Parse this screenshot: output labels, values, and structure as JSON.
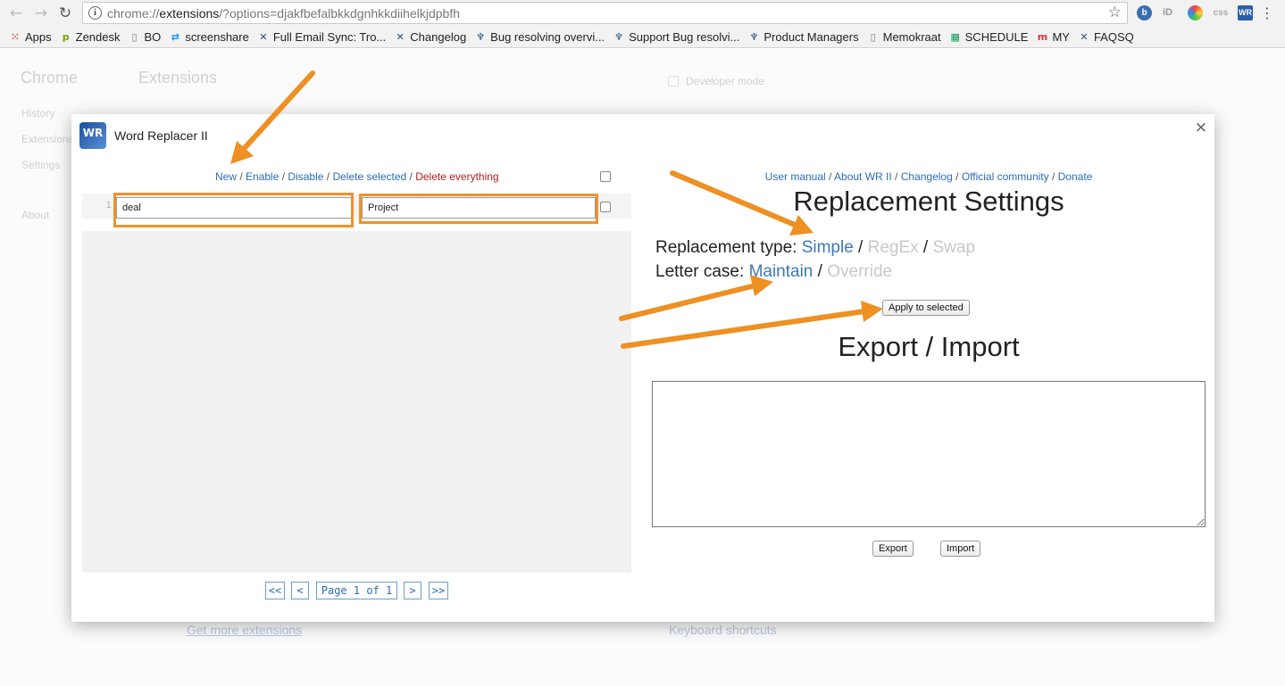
{
  "browser": {
    "url_prefix": "chrome://",
    "url_host": "extensions",
    "url_rest": "/?options=djakfbefalbkkdgnhkkdiihelkjdpbfh",
    "extension_icons": [
      "b",
      "iD",
      "C",
      "css",
      "WR"
    ]
  },
  "bookmarks": [
    {
      "label": "Apps",
      "icon": "apps-grid-icon",
      "color": "#d44"
    },
    {
      "label": "Zendesk",
      "icon": "zendesk-icon",
      "color": "#78a300"
    },
    {
      "label": "BO",
      "icon": "page-icon",
      "color": "#777"
    },
    {
      "label": "screenshare",
      "icon": "teamviewer-icon",
      "color": "#0e8ee9"
    },
    {
      "label": "Full Email Sync: Tro...",
      "icon": "jira-icon",
      "color": "#205081"
    },
    {
      "label": "Changelog",
      "icon": "jira-icon",
      "color": "#205081"
    },
    {
      "label": "Bug resolving overvi...",
      "icon": "confluence-icon",
      "color": "#205081"
    },
    {
      "label": "Support Bug resolvi...",
      "icon": "confluence-icon",
      "color": "#205081"
    },
    {
      "label": "Product Managers",
      "icon": "confluence-icon",
      "color": "#205081"
    },
    {
      "label": "Memokraat",
      "icon": "page-icon",
      "color": "#777"
    },
    {
      "label": "SCHEDULE",
      "icon": "sheets-icon",
      "color": "#0f9d58"
    },
    {
      "label": "MY",
      "icon": "my-icon",
      "color": "#d33"
    },
    {
      "label": "FAQSQ",
      "icon": "jira-icon",
      "color": "#205081"
    }
  ],
  "background_page": {
    "brand": "Chrome",
    "title": "Extensions",
    "nav": [
      "History",
      "Extensions",
      "Settings",
      "About"
    ],
    "developer_mode": "Developer mode",
    "get_more": "Get more extensions",
    "keyboard_shortcuts": "Keyboard shortcuts"
  },
  "dialog": {
    "title": "Word Replacer II",
    "logo_text": "WR",
    "close": "×",
    "actions": {
      "new": "New",
      "enable": "Enable",
      "disable": "Disable",
      "delete_selected": "Delete selected",
      "delete_everything": "Delete everything",
      "separator": " / "
    },
    "rules": [
      {
        "num": "1",
        "find": "deal",
        "replace": "Project"
      }
    ],
    "pagination": {
      "first": "<<",
      "prev": "<",
      "label": "Page 1 of 1",
      "next": ">",
      "last": ">>"
    },
    "links": {
      "manual": "User manual",
      "about": "About WR II",
      "changelog": "Changelog",
      "community": "Official community",
      "donate": "Donate"
    },
    "settings_heading": "Replacement Settings",
    "replacement_type": {
      "label": "Replacement type:",
      "simple": "Simple",
      "regex": "RegEx",
      "swap": "Swap",
      "selected": "Simple"
    },
    "letter_case": {
      "label": "Letter case:",
      "maintain": "Maintain",
      "override": "Override",
      "selected": "Maintain"
    },
    "apply_button": "Apply to selected",
    "export_heading": "Export / Import",
    "export_text": "",
    "export_button": "Export",
    "import_button": "Import"
  },
  "colors": {
    "link": "#2a6cb8",
    "danger": "#b31d1d",
    "selected_option": "#3c78b8",
    "unselected_option": "#c8c8c8",
    "highlight": "#f0922b"
  }
}
